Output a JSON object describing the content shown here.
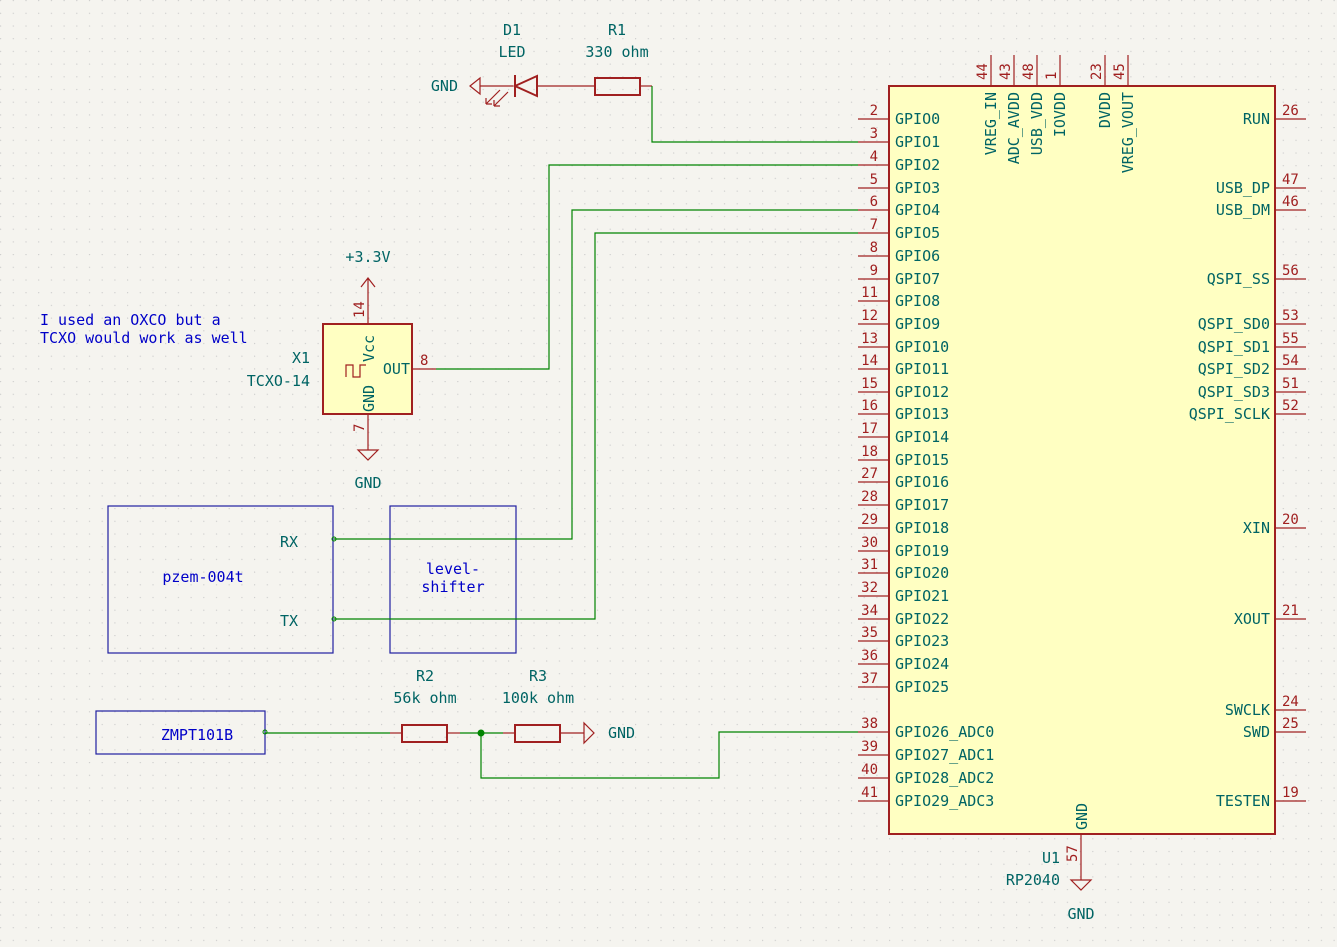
{
  "notes": {
    "line1": "I used an OXCO but a",
    "line2": "TCXO would work as well"
  },
  "led": {
    "ref": "D1",
    "value": "LED",
    "gnd": "GND"
  },
  "r1": {
    "ref": "R1",
    "value": "330 ohm"
  },
  "x1": {
    "ref": "X1",
    "value": "TCXO-14",
    "pin_vcc_name": "Vcc",
    "pin_vcc_num": "14",
    "pin_gnd_name": "GND",
    "pin_gnd_num": "7",
    "pin_out_name": "OUT",
    "pin_out_num": "8",
    "power": "+3.3V",
    "gnd": "GND"
  },
  "pzem": {
    "label": "pzem-004t",
    "rx": "RX",
    "tx": "TX"
  },
  "shifter": {
    "line1": "level-",
    "line2": "shifter"
  },
  "zmpt": {
    "label": "ZMPT101B"
  },
  "r2": {
    "ref": "R2",
    "value": "56k ohm"
  },
  "r3": {
    "ref": "R3",
    "value": "100k ohm",
    "gnd": "GND"
  },
  "u1": {
    "ref": "U1",
    "value": "RP2040",
    "gnd_label": "GND",
    "gnd_pin_name": "GND",
    "gnd_pin_num": "57",
    "left_pins": [
      {
        "name": "GPIO0",
        "num": "2"
      },
      {
        "name": "GPIO1",
        "num": "3"
      },
      {
        "name": "GPIO2",
        "num": "4"
      },
      {
        "name": "GPIO3",
        "num": "5"
      },
      {
        "name": "GPIO4",
        "num": "6"
      },
      {
        "name": "GPIO5",
        "num": "7"
      },
      {
        "name": "GPIO6",
        "num": "8"
      },
      {
        "name": "GPIO7",
        "num": "9"
      },
      {
        "name": "GPIO8",
        "num": "11"
      },
      {
        "name": "GPIO9",
        "num": "12"
      },
      {
        "name": "GPIO10",
        "num": "13"
      },
      {
        "name": "GPIO11",
        "num": "14"
      },
      {
        "name": "GPIO12",
        "num": "15"
      },
      {
        "name": "GPIO13",
        "num": "16"
      },
      {
        "name": "GPIO14",
        "num": "17"
      },
      {
        "name": "GPIO15",
        "num": "18"
      },
      {
        "name": "GPIO16",
        "num": "27"
      },
      {
        "name": "GPIO17",
        "num": "28"
      },
      {
        "name": "GPIO18",
        "num": "29"
      },
      {
        "name": "GPIO19",
        "num": "30"
      },
      {
        "name": "GPIO20",
        "num": "31"
      },
      {
        "name": "GPIO21",
        "num": "32"
      },
      {
        "name": "GPIO22",
        "num": "34"
      },
      {
        "name": "GPIO23",
        "num": "35"
      },
      {
        "name": "GPIO24",
        "num": "36"
      },
      {
        "name": "GPIO25",
        "num": "37"
      },
      {
        "name": "GPIO26_ADC0",
        "num": "38"
      },
      {
        "name": "GPIO27_ADC1",
        "num": "39"
      },
      {
        "name": "GPIO28_ADC2",
        "num": "40"
      },
      {
        "name": "GPIO29_ADC3",
        "num": "41"
      }
    ],
    "top_pins": [
      {
        "name": "VREG_IN",
        "num": "44"
      },
      {
        "name": "ADC_AVDD",
        "num": "43"
      },
      {
        "name": "USB_VDD",
        "num": "48"
      },
      {
        "name": "IOVDD",
        "num": "1"
      },
      {
        "name": "DVDD",
        "num": "23"
      },
      {
        "name": "VREG_VOUT",
        "num": "45"
      }
    ],
    "right_pins": [
      {
        "name": "RUN",
        "num": "26"
      },
      {
        "name": "USB_DP",
        "num": "47"
      },
      {
        "name": "USB_DM",
        "num": "46"
      },
      {
        "name": "QSPI_SS",
        "num": "56"
      },
      {
        "name": "QSPI_SD0",
        "num": "53"
      },
      {
        "name": "QSPI_SD1",
        "num": "55"
      },
      {
        "name": "QSPI_SD2",
        "num": "54"
      },
      {
        "name": "QSPI_SD3",
        "num": "51"
      },
      {
        "name": "QSPI_SCLK",
        "num": "52"
      },
      {
        "name": "XIN",
        "num": "20"
      },
      {
        "name": "XOUT",
        "num": "21"
      },
      {
        "name": "SWCLK",
        "num": "24"
      },
      {
        "name": "SWD",
        "num": "25"
      },
      {
        "name": "TESTEN",
        "num": "19"
      }
    ]
  }
}
